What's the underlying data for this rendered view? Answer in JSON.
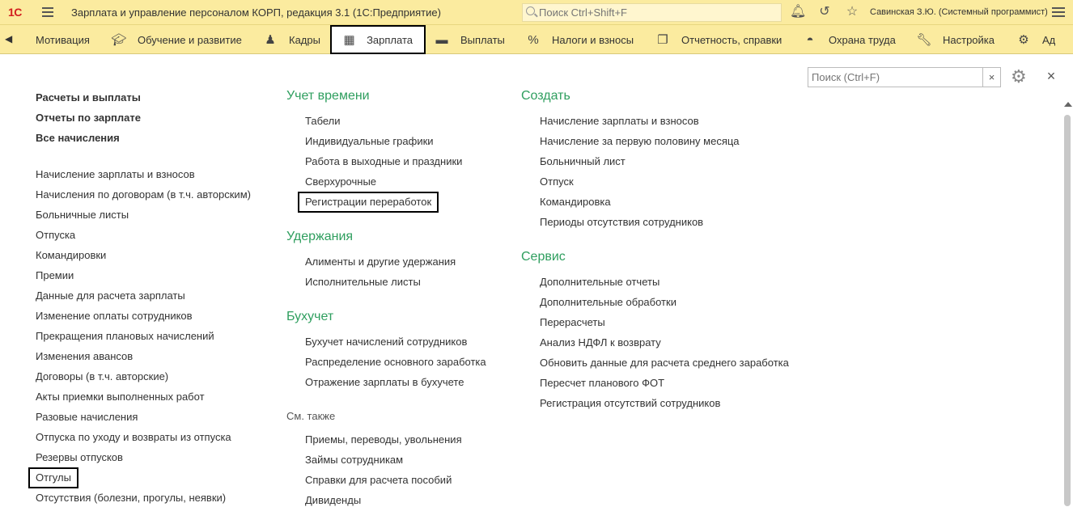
{
  "titlebar": {
    "logo": "1С",
    "app_title": "Зарплата и управление персоналом КОРП, редакция 3.1   (1С:Предприятие)",
    "search_placeholder": "Поиск Ctrl+Shift+F",
    "user": "Савинская З.Ю. (Системный программист)",
    "icons": [
      "bell-icon",
      "history-icon",
      "star-icon",
      "menu-icon"
    ]
  },
  "sections": [
    {
      "label": "Мотивация",
      "icon": "",
      "active": false
    },
    {
      "label": "Обучение и развитие",
      "icon": "graduation-cap-icon",
      "active": false
    },
    {
      "label": "Кадры",
      "icon": "users-icon",
      "active": false
    },
    {
      "label": "Зарплата",
      "icon": "calculator-icon",
      "active": true
    },
    {
      "label": "Выплаты",
      "icon": "wallet-icon",
      "active": false
    },
    {
      "label": "Налоги и взносы",
      "icon": "percent-icon",
      "active": false
    },
    {
      "label": "Отчетность, справки",
      "icon": "documents-icon",
      "active": false
    },
    {
      "label": "Охрана труда",
      "icon": "helmet-icon",
      "active": false
    },
    {
      "label": "Настройка",
      "icon": "wrench-icon",
      "active": false
    },
    {
      "label": "Ад",
      "icon": "gear-icon",
      "active": false
    }
  ],
  "local_search": {
    "placeholder": "Поиск (Ctrl+F)",
    "clear": "×"
  },
  "close_label": "×",
  "left_column": {
    "top_links": [
      "Расчеты и выплаты",
      "Отчеты по зарплате",
      "Все начисления"
    ],
    "items": [
      "Начисление зарплаты и взносов",
      "Начисления по договорам (в т.ч. авторским)",
      "Больничные листы",
      "Отпуска",
      "Командировки",
      "Премии",
      "Данные для расчета зарплаты",
      "Изменение оплаты сотрудников",
      "Прекращения плановых начислений",
      "Изменения авансов",
      "Договоры (в т.ч. авторские)",
      "Акты приемки выполненных работ",
      "Разовые начисления",
      "Отпуска по уходу и возвраты из отпуска",
      "Резервы отпусков",
      "Отгулы",
      "Отсутствия (болезни, прогулы, неявки)"
    ]
  },
  "middle_column": {
    "groups": [
      {
        "title": "Учет времени",
        "items": [
          "Табели",
          "Индивидуальные графики",
          "Работа в выходные и праздники",
          "Сверхурочные",
          "Регистрации переработок"
        ]
      },
      {
        "title": "Удержания",
        "items": [
          "Алименты и другие удержания",
          "Исполнительные листы"
        ]
      },
      {
        "title": "Бухучет",
        "items": [
          "Бухучет начислений сотрудников",
          "Распределение основного заработка",
          "Отражение зарплаты в бухучете"
        ]
      }
    ],
    "see_also_title": "См. также",
    "see_also": [
      "Приемы, переводы, увольнения",
      "Займы сотрудникам",
      "Справки для расчета пособий",
      "Дивиденды"
    ]
  },
  "right_column": {
    "groups": [
      {
        "title": "Создать",
        "items": [
          "Начисление зарплаты и взносов",
          "Начисление за первую половину месяца",
          "Больничный лист",
          "Отпуск",
          "Командировка",
          "Периоды отсутствия сотрудников"
        ]
      },
      {
        "title": "Сервис",
        "items": [
          "Дополнительные отчеты",
          "Дополнительные обработки",
          "Перерасчеты",
          "Анализ НДФЛ к возврату",
          "Обновить данные для расчета среднего заработка",
          "Пересчет планового ФОТ",
          "Регистрация отсутствий сотрудников"
        ]
      }
    ]
  },
  "colors": {
    "toolbar": "#fbeb9f",
    "group_title": "#2e9e5e",
    "logo": "#d21f1f"
  }
}
